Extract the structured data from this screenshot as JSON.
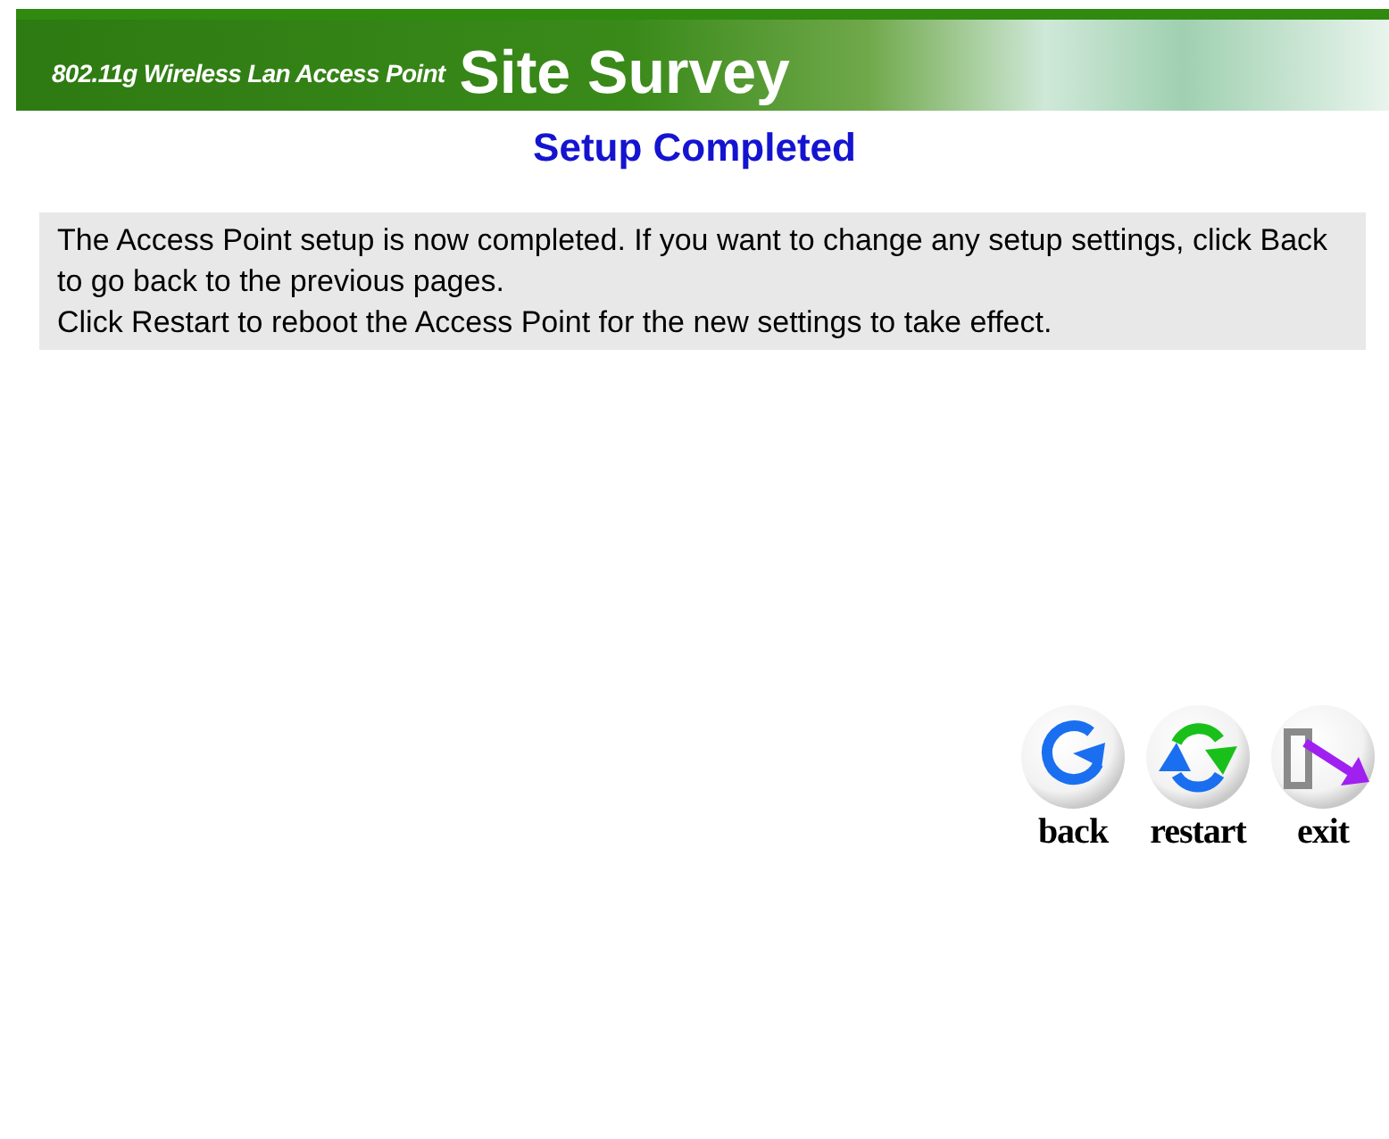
{
  "banner": {
    "subtitle": "802.11g Wireless Lan Access Point",
    "title": "Site Survey"
  },
  "heading": "Setup Completed",
  "message": [
    "The Access Point setup is now completed. If you want to change any setup settings, click Back to go back to the previous pages.",
    "Click Restart to reboot the Access Point for the new settings to take effect."
  ],
  "buttons": [
    {
      "kind": "back",
      "label": "back"
    },
    {
      "kind": "restart",
      "label": "restart"
    },
    {
      "kind": "exit",
      "label": "exit"
    }
  ]
}
